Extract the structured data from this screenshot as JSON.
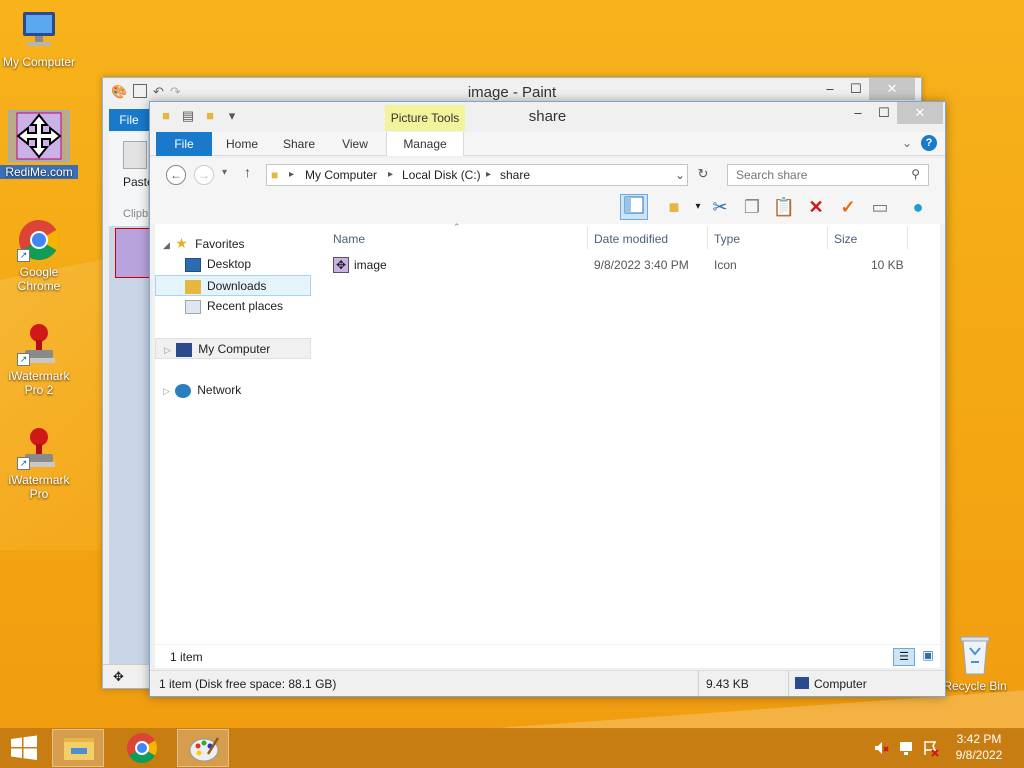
{
  "desktop": {
    "icons": [
      {
        "label": "My Computer",
        "icon": "computer-icon"
      },
      {
        "label": "RediMe.com",
        "icon": "move-arrows-icon"
      },
      {
        "label": "Google Chrome",
        "icon": "chrome-icon"
      },
      {
        "label": "iWatermark Pro 2",
        "icon": "stamp-icon"
      },
      {
        "label": "iWatermark Pro",
        "icon": "stamp-icon"
      },
      {
        "label": "Recycle Bin",
        "icon": "recycle-bin-icon"
      }
    ]
  },
  "paint": {
    "title": "image - Paint",
    "file_tab": "File",
    "paste_label": "Paste",
    "clipboard_label": "Clipb"
  },
  "explorer": {
    "title": "share",
    "picture_tools": "Picture Tools",
    "tabs": [
      "File",
      "Home",
      "Share",
      "View",
      "Manage"
    ],
    "address": [
      "My Computer",
      "Local Disk (C:)",
      "share"
    ],
    "search_placeholder": "Search share",
    "nav": {
      "favorites": "Favorites",
      "desktop": "Desktop",
      "downloads": "Downloads",
      "recent": "Recent places",
      "computer": "My Computer",
      "network": "Network"
    },
    "columns": [
      "Name",
      "Date modified",
      "Type",
      "Size"
    ],
    "files": [
      {
        "name": "image",
        "date": "9/8/2022 3:40 PM",
        "type": "Icon",
        "size": "10 KB"
      }
    ],
    "item_count": "1 item",
    "status_left": "1 item (Disk free space: 88.1 GB)",
    "status_size": "9.43 KB",
    "status_location": "Computer"
  },
  "taskbar": {
    "time": "3:42 PM",
    "date": "9/8/2022"
  },
  "colors": {
    "accent": "#1979ca",
    "desktop_bg": "#f4a712",
    "picture_tools": "#f3f39c"
  }
}
